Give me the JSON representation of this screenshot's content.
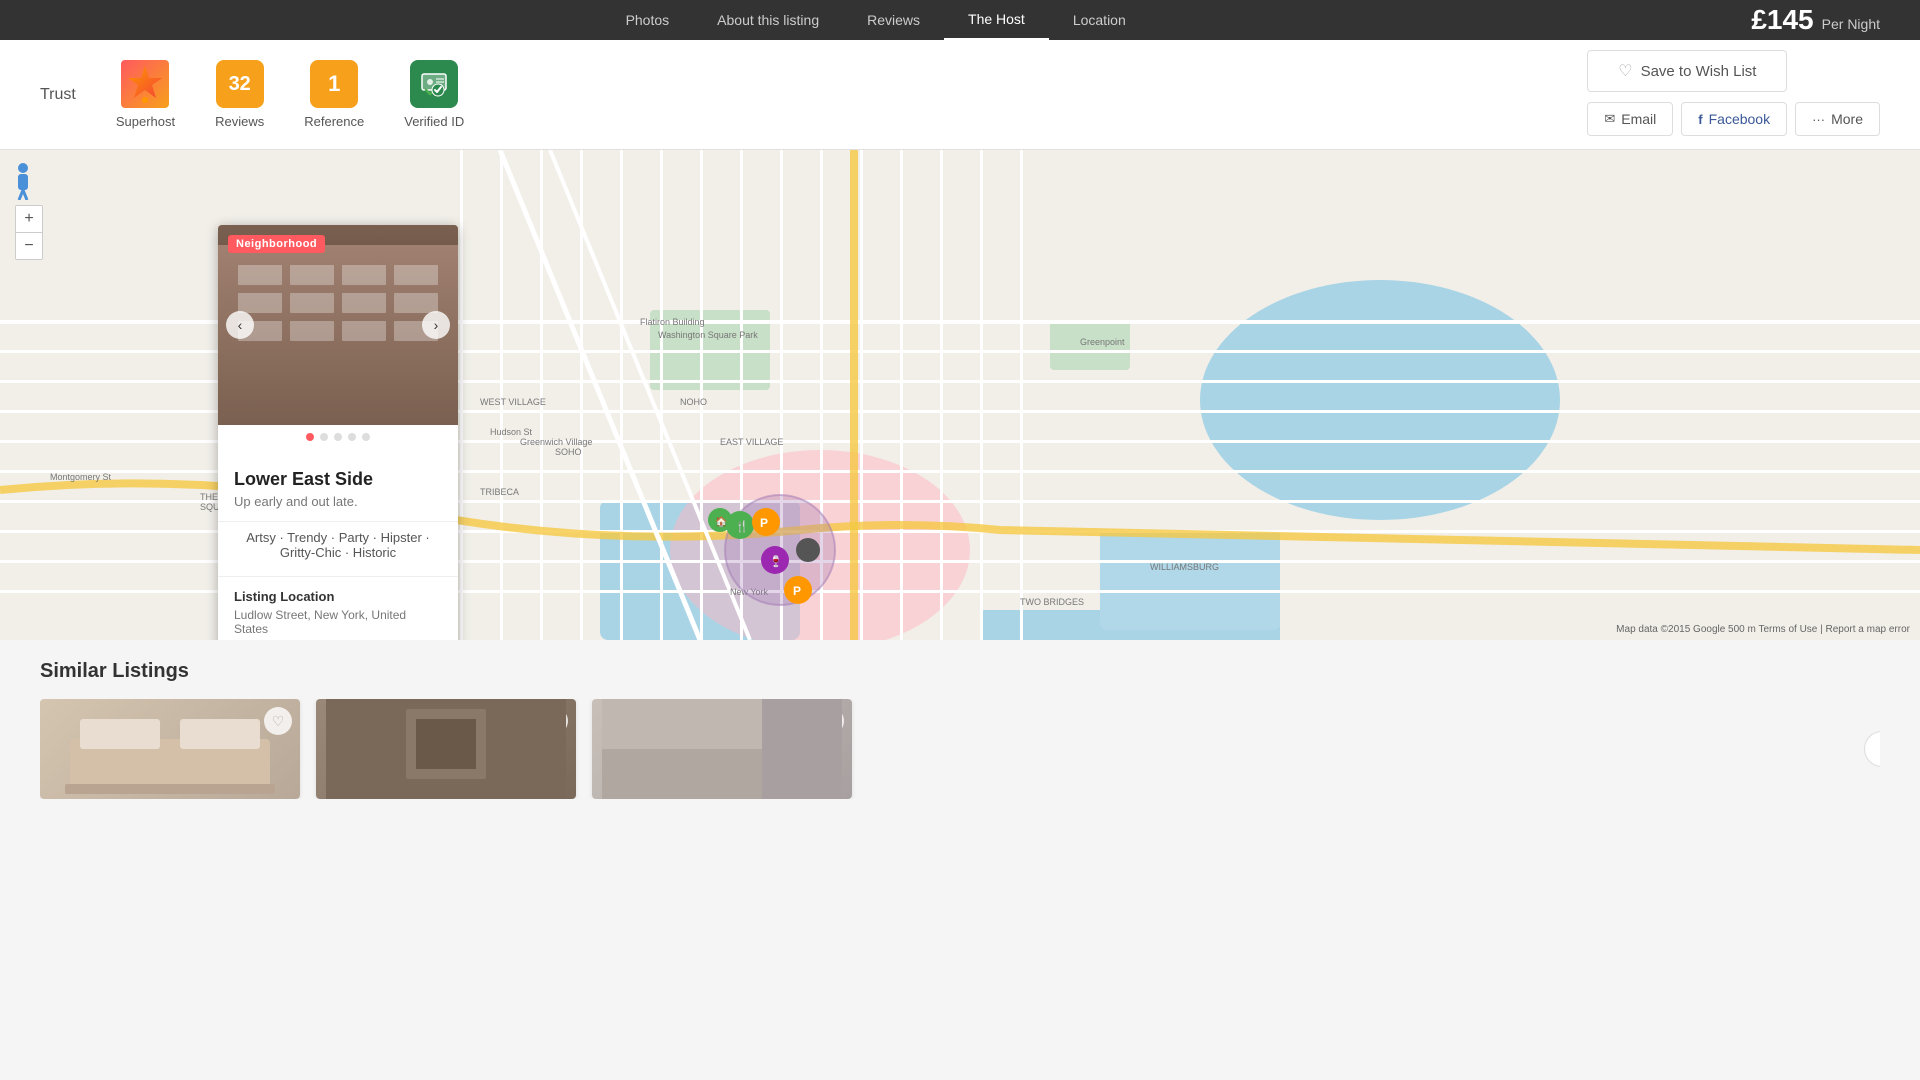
{
  "nav": {
    "items": [
      {
        "label": "Photos",
        "active": false
      },
      {
        "label": "About this listing",
        "active": false
      },
      {
        "label": "Reviews",
        "active": false
      },
      {
        "label": "The Host",
        "active": true
      },
      {
        "label": "Location",
        "active": false
      }
    ]
  },
  "pricing": {
    "amount": "£145",
    "per_night": "Per Night"
  },
  "actions": {
    "wish_list": "Save to Wish List",
    "email": "Email",
    "facebook": "Facebook",
    "more": "More"
  },
  "trust": {
    "label": "Trust",
    "badges": [
      {
        "id": "superhost",
        "label": "Superhost"
      },
      {
        "id": "reviews",
        "value": "32",
        "label": "Reviews"
      },
      {
        "id": "reference",
        "value": "1",
        "label": "Reference"
      },
      {
        "id": "verified",
        "label": "Verified ID"
      }
    ]
  },
  "neighborhood": {
    "badge": "Neighborhood",
    "title": "Lower East Side",
    "subtitle": "Up early and out late.",
    "tags": "Artsy · Trendy · Party · Hipster · Gritty-Chic · Historic",
    "location_title": "Listing Location",
    "location_address": "Ludlow Street, New York, United States"
  },
  "carousel": {
    "dots": [
      true,
      false,
      false,
      false,
      false
    ],
    "prev_label": "‹",
    "next_label": "›"
  },
  "map": {
    "zoom_in": "+",
    "zoom_out": "−",
    "footer": "Map data ©2015 Google  500 m  Terms of Use | Report a map error"
  },
  "similar": {
    "title": "Similar Listings",
    "listings": [
      {
        "id": 1
      },
      {
        "id": 2
      },
      {
        "id": 3
      }
    ],
    "next_label": "›"
  }
}
